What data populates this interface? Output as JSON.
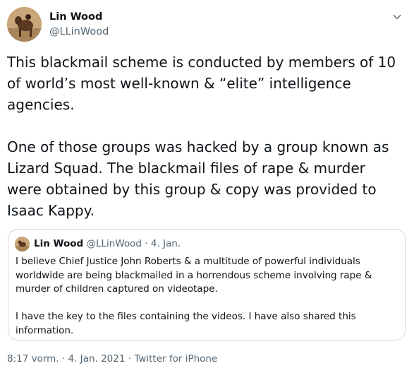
{
  "author": {
    "name": "Lin Wood",
    "handle": "@LLinWood"
  },
  "tweet": {
    "text": "This blackmail scheme is conducted by members of 10 of world’s most well-known & “elite” intelligence agencies.\n\nOne of those groups was hacked by a group known as Lizard Squad. The blackmail files of rape & murder were obtained by this group & copy was provided to Isaac Kappy."
  },
  "quote": {
    "name": "Lin Wood",
    "handle": "@LLinWood",
    "separator": "·",
    "date": "4. Jan.",
    "text": "I believe Chief Justice John Roberts & a multitude of powerful individuals worldwide are being blackmailed in a horrendous scheme involving rape & murder of children captured on videotape.\n\nI have the key to the files containing the videos. I have also shared this information."
  },
  "footer": {
    "time": "8:17 vorm.",
    "separator": "·",
    "date": "4. Jan. 2021",
    "source": "Twitter for iPhone"
  },
  "icons": {
    "more": "chevron-down-icon"
  },
  "colors": {
    "text": "#0f1419",
    "secondary": "#536471",
    "border": "#cfd9de"
  }
}
